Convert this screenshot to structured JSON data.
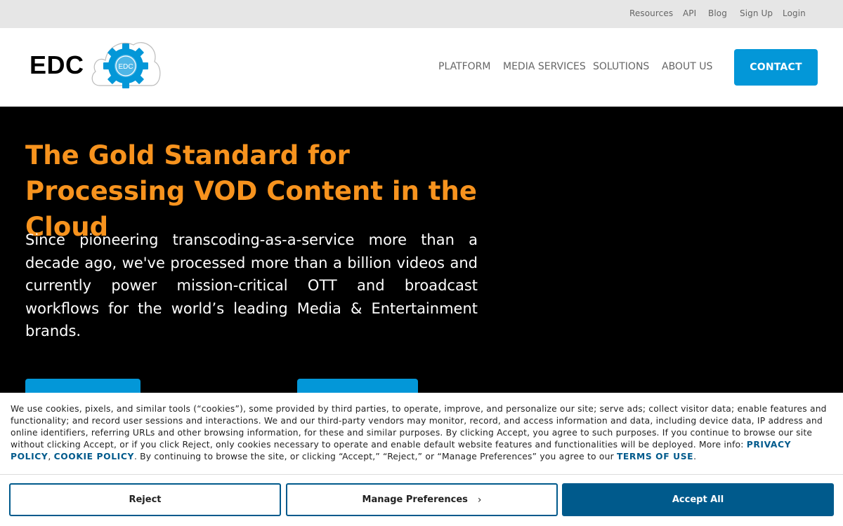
{
  "topbar": {
    "links": [
      "Resources",
      "API",
      "Blog",
      "Sign Up",
      "Login"
    ]
  },
  "header": {
    "logo_text": "EDC",
    "logo_badge": "EDC",
    "nav": [
      "PLATFORM",
      "MEDIA SERVICES",
      "SOLUTIONS",
      "ABOUT US"
    ],
    "contact_label": "CONTACT"
  },
  "hero": {
    "title": "The Gold Standard for Processing VOD Content in the Cloud",
    "text": "Since pioneering transcoding-as-a-service more than a decade ago, we've processed more than a billion videos and currently power mission-critical OTT and broadcast workflows for the world’s leading Media & Entertainment brands."
  },
  "cookie": {
    "text_1": "We use cookies, pixels, and similar tools (“cookies”), some provided by third parties, to operate, improve, and personalize our site; serve ads; collect visitor data; enable features and functionality; and record user sessions and interactions. We and our third-party vendors may monitor, record, and access information and data, including device data, IP address and online identifiers, referring URLs and other browsing information, for these and similar purposes. By clicking Accept, you agree to such purposes. If you continue to browse our site without clicking Accept, or if you click Reject, only cookies necessary to operate and enable default website features and functionalities will be deployed. More info: ",
    "privacy_link": "PRIVACY POLICY",
    "sep": ", ",
    "cookie_link": "COOKIE POLICY",
    "text_2": ". By continuing to browse the site, or clicking “Accept,” “Reject,” or “Manage Preferences” you agree to our ",
    "terms_link": "TERMS OF USE",
    "text_3": ".",
    "reject_label": "Reject",
    "manage_label": "Manage Preferences",
    "accept_label": "Accept All"
  },
  "colors": {
    "accent_blue": "#0397d8",
    "hero_title_orange": "#f7931e",
    "cookie_blue": "#005a8c"
  }
}
